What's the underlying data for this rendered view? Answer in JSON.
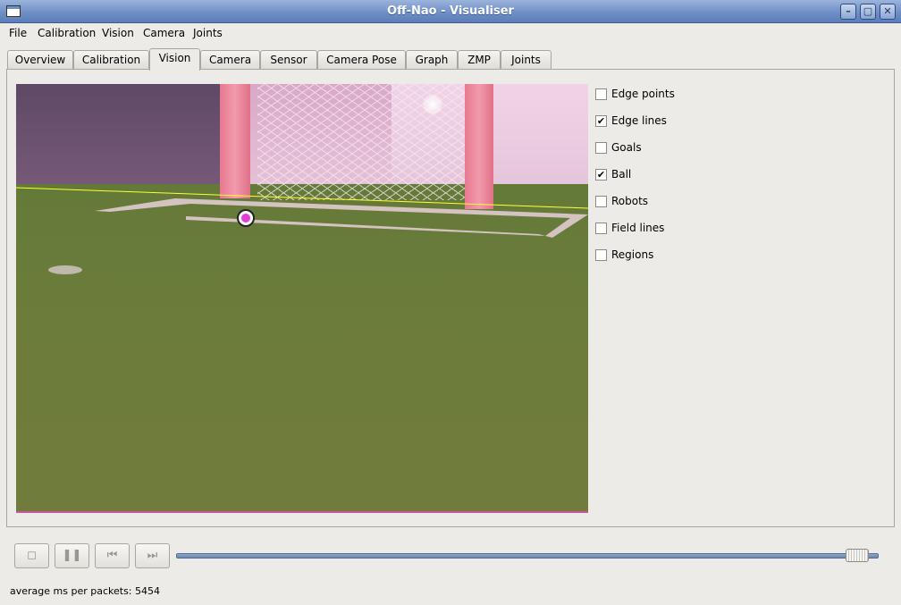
{
  "window": {
    "title": "Off-Nao - Visualiser"
  },
  "menu": [
    "File",
    "Calibration",
    "Vision",
    "Camera",
    "Joints"
  ],
  "tabs": [
    "Overview",
    "Calibration",
    "Vision",
    "Camera",
    "Sensor",
    "Camera Pose",
    "Graph",
    "ZMP",
    "Joints"
  ],
  "active_tab": "Vision",
  "overlay_options": [
    {
      "label": "Edge points",
      "checked": false
    },
    {
      "label": "Edge lines",
      "checked": true
    },
    {
      "label": "Goals",
      "checked": false
    },
    {
      "label": "Ball",
      "checked": true
    },
    {
      "label": "Robots",
      "checked": false
    },
    {
      "label": "Field lines",
      "checked": false
    },
    {
      "label": "Regions",
      "checked": false
    }
  ],
  "playback": {
    "buttons": [
      "stop-icon",
      "pause-icon",
      "rewind-icon",
      "fast-forward-icon"
    ],
    "position": 0.985
  },
  "status": {
    "text": "average ms per packets: 5454"
  },
  "colors": {
    "edge_line": "#ffff33",
    "ball_marker": "#e03ed8",
    "slider": "#6b86af"
  }
}
